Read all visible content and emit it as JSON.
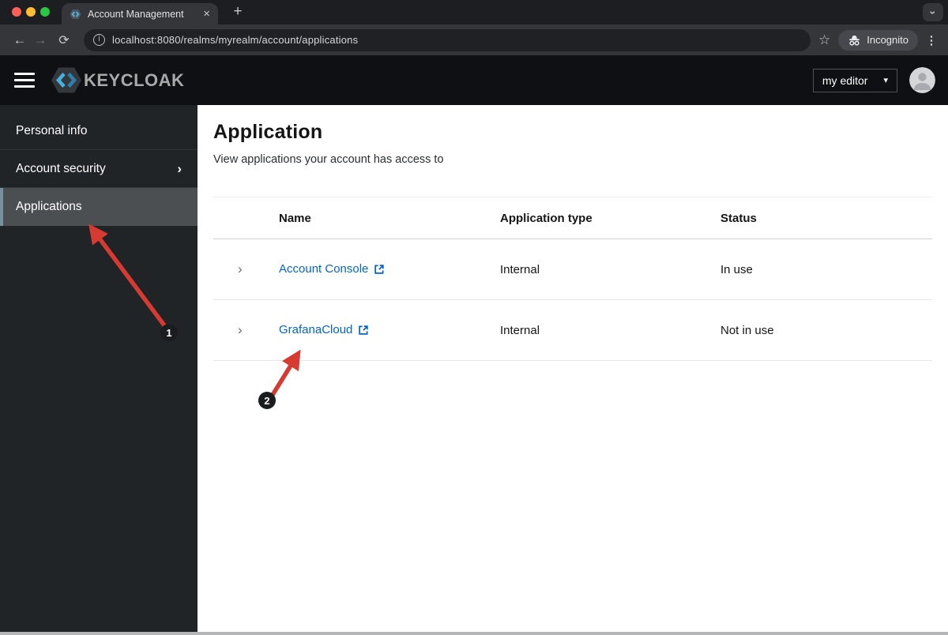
{
  "browser": {
    "tab_title": "Account Management",
    "url": "localhost:8080/realms/myrealm/account/applications",
    "incognito_label": "Incognito"
  },
  "header": {
    "logo_text": "KEYCLOAK",
    "realm_selector_value": "my editor"
  },
  "sidebar": {
    "items": [
      {
        "label": "Personal info",
        "selected": false,
        "expandable": false
      },
      {
        "label": "Account security",
        "selected": false,
        "expandable": true
      },
      {
        "label": "Applications",
        "selected": true,
        "expandable": false
      }
    ]
  },
  "main": {
    "title": "Application",
    "subtitle": "View applications your account has access to",
    "table": {
      "columns": [
        "Name",
        "Application type",
        "Status"
      ],
      "rows": [
        {
          "name": "Account Console",
          "type": "Internal",
          "status": "In use",
          "external_link": true
        },
        {
          "name": "GrafanaCloud",
          "type": "Internal",
          "status": "Not in use",
          "external_link": true
        }
      ]
    }
  },
  "annotations": {
    "step1": {
      "label": "1"
    },
    "step2": {
      "label": "2"
    }
  },
  "icons": {
    "back": "←",
    "forward": "→",
    "reload": "⟳",
    "info": "i",
    "star": "☆",
    "kebab": "⋮",
    "new_tab": "+",
    "tab_close": "×",
    "caret_down": "▾",
    "chevron_right": "›"
  },
  "colors": {
    "sidebar_accent": "#7891a0",
    "link_blue": "#0066cc",
    "annotation_red": "#d73a31",
    "traffic_red": "#ff5f57",
    "traffic_yellow": "#febc2e",
    "traffic_green": "#28c840"
  }
}
